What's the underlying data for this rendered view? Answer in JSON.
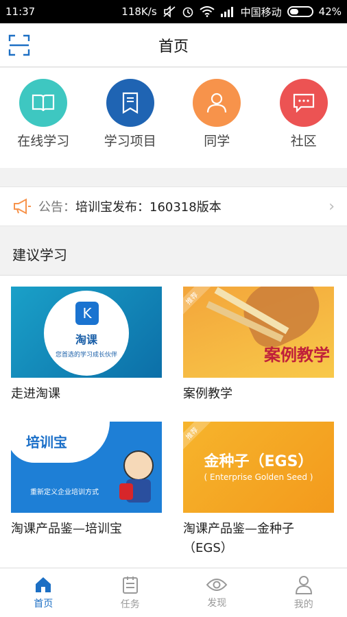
{
  "status": {
    "time": "11:37",
    "speed": "118K/s",
    "carrier": "中国移动",
    "battery": "42%",
    "battery_level": 0.42
  },
  "header": {
    "title": "首页"
  },
  "quick": [
    {
      "label": "在线学习",
      "color": "#3ec7c1",
      "icon": "book-icon"
    },
    {
      "label": "学习项目",
      "color": "#1f64b3",
      "icon": "bookmark-icon"
    },
    {
      "label": "同学",
      "color": "#f7934b",
      "icon": "person-icon"
    },
    {
      "label": "社区",
      "color": "#ec5353",
      "icon": "chat-icon"
    }
  ],
  "notice": {
    "prefix": "公告：",
    "text": "培训宝发布：160318版本"
  },
  "section": {
    "title": "建议学习"
  },
  "cards": [
    {
      "caption": "走进淘课",
      "thumb_title": "淘课",
      "thumb_sub": "您首选的学习成长伙伴",
      "tag": ""
    },
    {
      "caption": "案例教学",
      "thumb_title": "案例教学",
      "thumb_sub": "",
      "tag": "推荐"
    },
    {
      "caption": "淘课产品鉴—培训宝",
      "thumb_title": "培训宝",
      "thumb_sub": "重新定义企业培训方式",
      "tag": ""
    },
    {
      "caption": "淘课产品鉴—金种子（EGS）",
      "thumb_title": "金种子（EGS）",
      "thumb_sub": "( Enterprise Golden Seed )",
      "tag": "推荐"
    }
  ],
  "tabs": [
    {
      "label": "首页",
      "icon": "home-icon",
      "active": true
    },
    {
      "label": "任务",
      "icon": "clipboard-icon",
      "active": false
    },
    {
      "label": "发现",
      "icon": "eye-icon",
      "active": false
    },
    {
      "label": "我的",
      "icon": "user-icon",
      "active": false
    }
  ],
  "colors": {
    "accent": "#1c6fc4",
    "inactive": "#999999"
  }
}
